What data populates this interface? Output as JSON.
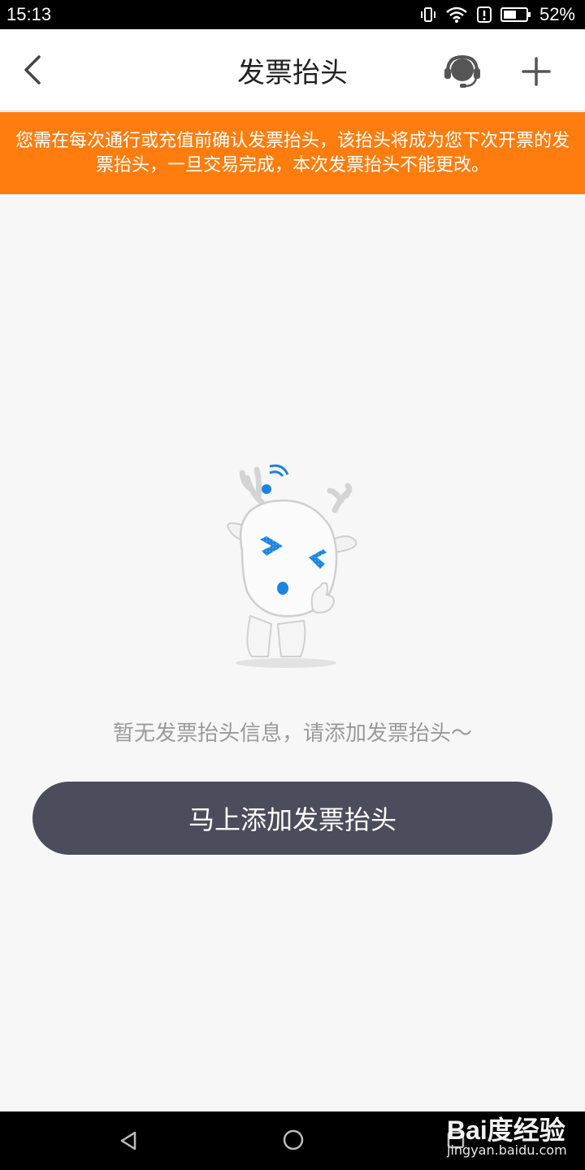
{
  "status_bar": {
    "time": "15:13",
    "battery_percent": "52%",
    "icons": [
      "vibrate-icon",
      "wifi-icon",
      "alert-icon",
      "battery-icon"
    ]
  },
  "nav": {
    "title": "发票抬头",
    "back_icon": "chevron-left-icon",
    "service_icon": "headset-icon",
    "add_icon": "plus-icon"
  },
  "notice": {
    "text": "您需在每次通行或充值前确认发票抬头，该抬头将成为您下次开票的发票抬头，一旦交易完成，本次发票抬头不能更改。",
    "background": "#ff7d0e"
  },
  "empty_state": {
    "message": "暂无发票抬头信息，请添加发票抬头～",
    "illustration": "deer-mascot"
  },
  "add_button": {
    "label": "马上添加发票抬头",
    "background": "#4b4c5c"
  },
  "system_nav": {
    "icons": [
      "triangle-back-icon",
      "circle-home-icon",
      "square-recent-icon"
    ]
  },
  "watermark": {
    "brand": "Bai度经验",
    "url": "jingyan.baidu.com"
  },
  "colors": {
    "accent": "#ff7d0e",
    "button": "#4b4c5c",
    "page_bg": "#f7f7f7",
    "mascot_blue": "#1b84e0"
  }
}
